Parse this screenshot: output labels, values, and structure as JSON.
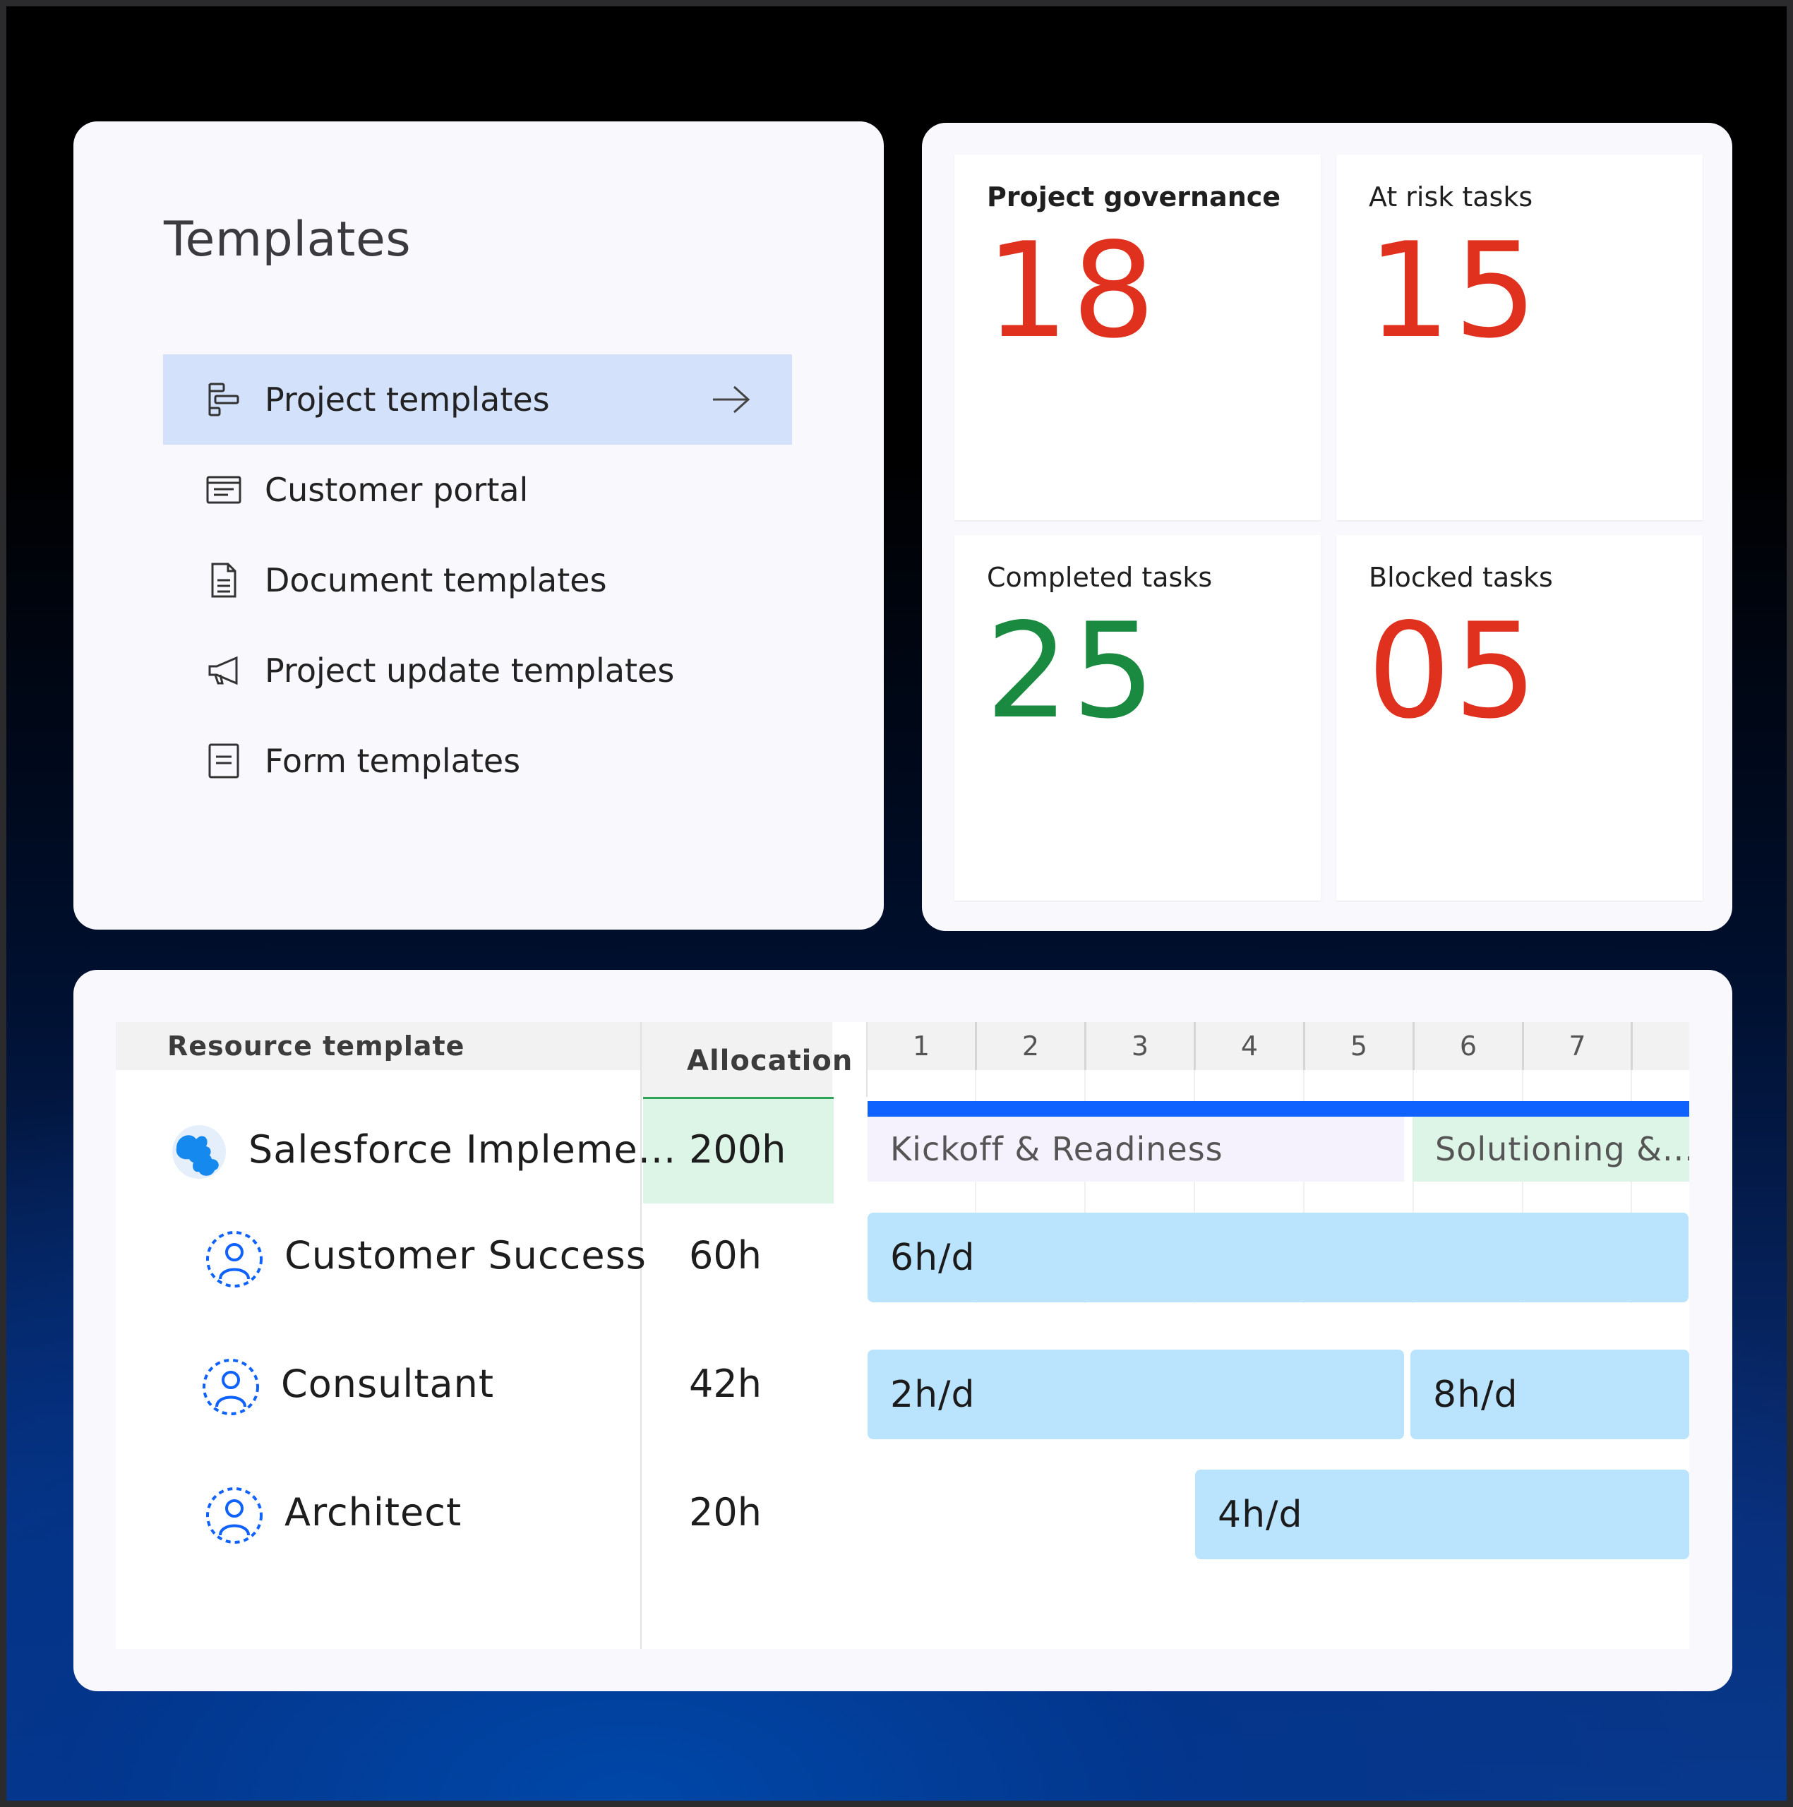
{
  "templates": {
    "title": "Templates",
    "items": [
      {
        "label": "Project templates",
        "icon": "gantt-icon",
        "active": true
      },
      {
        "label": "Customer portal",
        "icon": "portal-icon"
      },
      {
        "label": "Document templates",
        "icon": "document-icon"
      },
      {
        "label": "Project update templates",
        "icon": "megaphone-icon"
      },
      {
        "label": "Form templates",
        "icon": "form-icon"
      }
    ]
  },
  "metrics": [
    {
      "label": "Project governance",
      "value": "18",
      "color": "#e0301e"
    },
    {
      "label": "At risk tasks",
      "value": "15",
      "color": "#e0301e"
    },
    {
      "label": "Completed tasks",
      "value": "25",
      "color": "#198a3f"
    },
    {
      "label": "Blocked tasks",
      "value": "05",
      "color": "#e0301e"
    }
  ],
  "resource": {
    "header_template": "Resource template",
    "header_allocation": "Allocation",
    "days": [
      "1",
      "2",
      "3",
      "4",
      "5",
      "6",
      "7",
      ""
    ],
    "project": {
      "name": "Salesforce Impleme...",
      "allocation": "200h"
    },
    "phases": [
      {
        "label": "Kickoff & Readiness",
        "color": "#f6f2fd"
      },
      {
        "label": "Solutioning &...",
        "color": "#ddf5e6"
      }
    ],
    "roles": [
      {
        "name": "Customer Success",
        "allocation": "60h",
        "bars": [
          "6h/d"
        ]
      },
      {
        "name": "Consultant",
        "allocation": "42h",
        "bars": [
          "2h/d",
          "8h/d"
        ]
      },
      {
        "name": "Architect",
        "allocation": "20h",
        "bars": [
          "4h/d"
        ]
      }
    ],
    "colors": {
      "timeline": "#0f62fe",
      "bar": "#bae3fd",
      "allocation_highlight": "#ddf5e6"
    }
  }
}
